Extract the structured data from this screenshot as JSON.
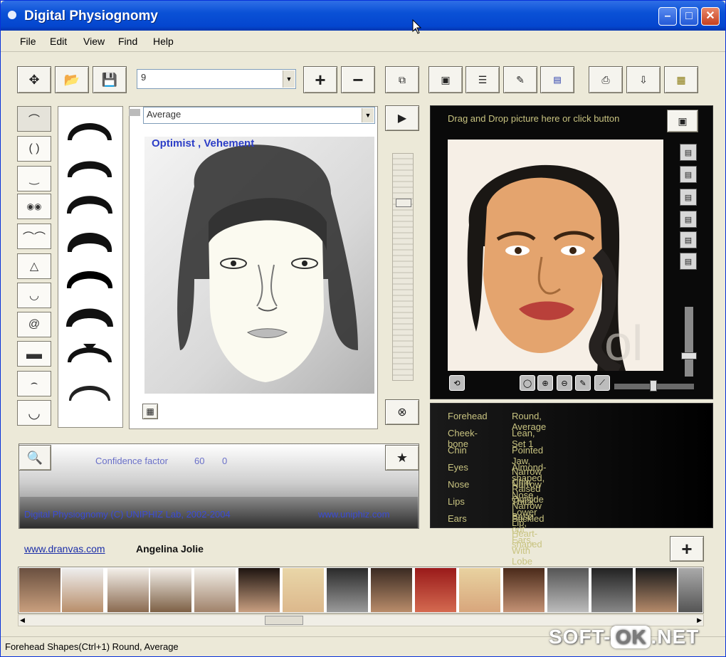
{
  "window": {
    "title": "Digital Physiognomy",
    "minimize": "–",
    "maximize": "□",
    "close": "✕"
  },
  "menu": [
    "File",
    "Edit",
    "View",
    "Find",
    "Help"
  ],
  "toolbar": {
    "combo_value": "9",
    "plus": "+",
    "minus": "−"
  },
  "left": {
    "variant_combo": "Average",
    "play": "▶",
    "sketch_title": "Optimist , Vehement",
    "stop": "⊗"
  },
  "confidence": {
    "label": "Confidence factor",
    "value_a": "60",
    "value_b": "0"
  },
  "footer_bar": {
    "copyright": "Digital Physiognomy (C) UNIPHIZ Lab, 2002-2004",
    "url": "www.uniphiz.com"
  },
  "right": {
    "drop_hint": "Drag and Drop picture here or click button"
  },
  "features": [
    {
      "label": "Forehead",
      "value": "Round, Average"
    },
    {
      "label": "Cheek-bone",
      "value": "Lean, Set  1"
    },
    {
      "label": "Chin",
      "value": "Pointed Jaw, Narrow Chin"
    },
    {
      "label": "Eyes",
      "value": "Almond-shaped, Raised Outside"
    },
    {
      "label": "Nose",
      "value": "Narrow Nose, Narrow Base"
    },
    {
      "label": "Lips",
      "value": "Thick Lower Lip, Heart-shaped"
    },
    {
      "label": "Ears",
      "value": "Stickled out Ears, With Lobe"
    }
  ],
  "bottom": {
    "link": "www.dranvas.com",
    "person": "Angelina Jolie",
    "add": "+"
  },
  "status": "Forehead Shapes(Ctrl+1) Round, Average",
  "watermark": {
    "a": "SOFT-",
    "b": "OK",
    "c": ".NET"
  },
  "colors": {
    "accent": "#0a51d6",
    "dark_panel": "#0a0a0a",
    "feature_text": "#c8c380"
  }
}
